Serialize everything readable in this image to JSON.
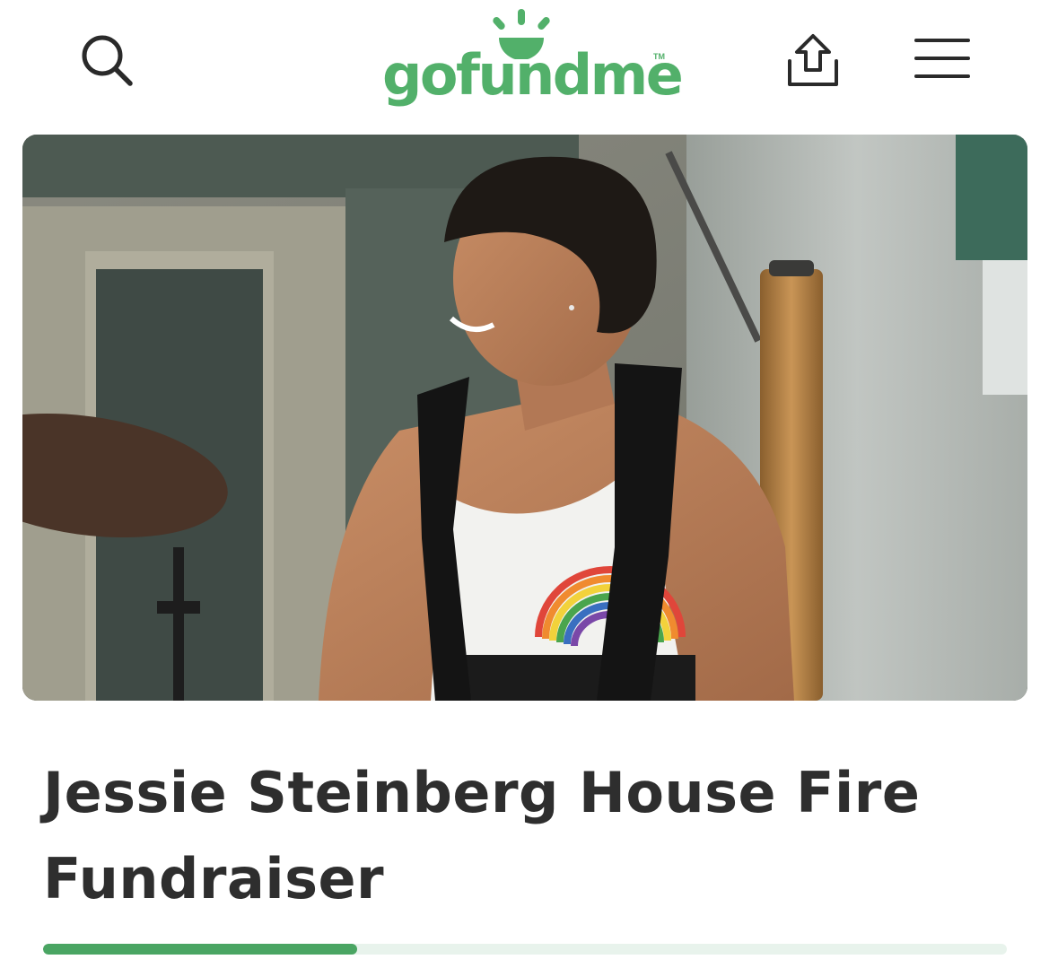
{
  "header": {
    "logo_text": "gofundme",
    "logo_trademark": "TM",
    "icons": {
      "search": "search-icon",
      "share": "share-icon",
      "menu": "hamburger-menu-icon"
    },
    "colors": {
      "brand_green": "#52b06a",
      "icon_dark": "#2a2a2a"
    }
  },
  "hero": {
    "image": "photo-of-drummer-smiling-in-white-tank-top"
  },
  "campaign": {
    "title": "Jessie Steinberg House Fire Fundraiser",
    "progress_fraction": 0.326,
    "progress_color": "#4aa563",
    "progress_track_color": "#e8f3ec"
  }
}
